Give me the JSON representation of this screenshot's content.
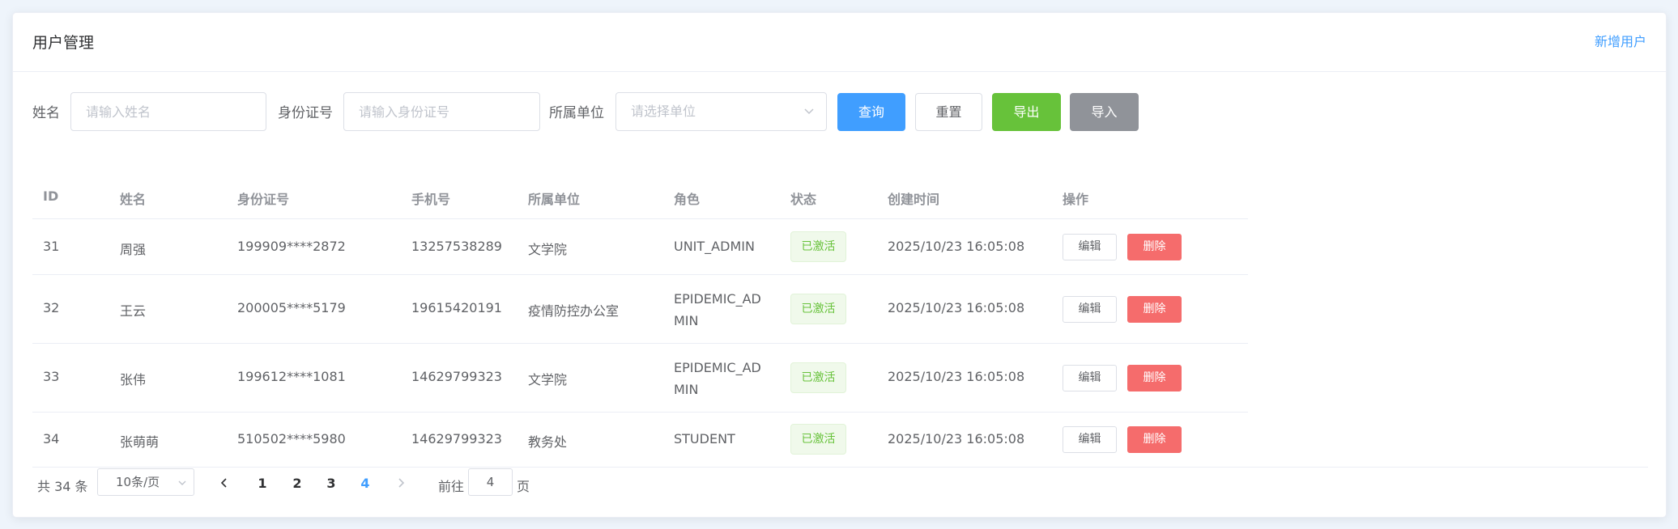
{
  "header": {
    "title": "用户管理",
    "add_user": "新增用户"
  },
  "filters": {
    "name_label": "姓名",
    "name_placeholder": "请输入姓名",
    "idcard_label": "身份证号",
    "idcard_placeholder": "请输入身份证号",
    "unit_label": "所属单位",
    "unit_placeholder": "请选择单位",
    "query": "查询",
    "reset": "重置",
    "export": "导出",
    "import": "导入"
  },
  "table": {
    "columns": [
      "ID",
      "姓名",
      "身份证号",
      "手机号",
      "所属单位",
      "角色",
      "状态",
      "创建时间",
      "操作"
    ],
    "rows": [
      {
        "id": "31",
        "name": "周强",
        "idcard": "199909****2872",
        "phone": "13257538289",
        "unit": "文学院",
        "role": "UNIT_ADMIN",
        "status": "已激活",
        "created": "2025/10/23 16:05:08",
        "edit": "编辑",
        "delete": "删除"
      },
      {
        "id": "32",
        "name": "王云",
        "idcard": "200005****5179",
        "phone": "19615420191",
        "unit": "疫情防控办公室",
        "role": "EPIDEMIC_ADMIN",
        "status": "已激活",
        "created": "2025/10/23 16:05:08",
        "edit": "编辑",
        "delete": "删除"
      },
      {
        "id": "33",
        "name": "张伟",
        "idcard": "199612****1081",
        "phone": "14629799323",
        "unit": "文学院",
        "role": "EPIDEMIC_ADMIN",
        "status": "已激活",
        "created": "2025/10/23 16:05:08",
        "edit": "编辑",
        "delete": "删除"
      },
      {
        "id": "34",
        "name": "张萌萌",
        "idcard": "510502****5980",
        "phone": "14629799323",
        "unit": "教务处",
        "role": "STUDENT",
        "status": "已激活",
        "created": "2025/10/23 16:05:08",
        "edit": "编辑",
        "delete": "删除"
      }
    ]
  },
  "pagination": {
    "total": "共 34 条",
    "page_size": "10条/页",
    "pages": [
      "1",
      "2",
      "3",
      "4"
    ],
    "current": "4",
    "goto_prefix": "前往",
    "goto_value": "4",
    "goto_suffix": "页"
  },
  "colors": {
    "primary": "#409eff",
    "success": "#67c23a",
    "danger": "#f56c6c",
    "info": "#909399"
  }
}
